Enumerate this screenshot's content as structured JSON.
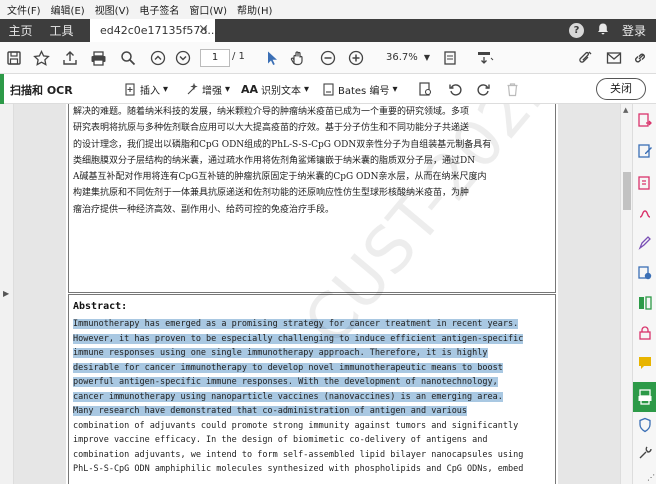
{
  "menubar": [
    "文件(F)",
    "编辑(E)",
    "视图(V)",
    "电子签名",
    "窗口(W)",
    "帮助(H)"
  ],
  "tabs": {
    "home": "主页",
    "tools": "工具",
    "document": "ed42c0e17135f57d...",
    "close_symbol": "×",
    "help_symbol": "?",
    "login": "登录"
  },
  "toolbar": {
    "page_current": "1",
    "page_total": "/ 1",
    "zoom": "36.7%"
  },
  "ocr": {
    "title": "扫描和 OCR",
    "insert": "插入",
    "enhance": "增强",
    "recognize_text": "识别文本",
    "bates": "Bates 编号",
    "close": "关闭"
  },
  "document": {
    "chinese_lines": [
      "解决的难题。随着纳米科技的发展，纳米颗粒介导的肿瘤纳米疫苗已成为一个重要的研究领域。多项",
      "研究表明将抗原与多种佐剂联合应用可以大大提高疫苗的疗效。基于分子仿生和不同功能分子共递送",
      "的设计理念，我们提出以磷脂和CpG  ODN组成的PhL-S-S-CpG  ODN双亲性分子为自组装基元制备具有",
      "类细胞膜双分子层结构的纳米囊，通过疏水作用将佐剂角鲨烯镶嵌于纳米囊的脂质双分子层，通过DN",
      "A碱基互补配对作用将连有CpG互补链的肿瘤抗原固定于纳米囊的CpG  ODN亲水层，从而在纳米尺度内",
      "构建集抗原和不同佐剂于一体兼具抗原递送和佐剂功能的还原响应性仿生型球形核酸纳米疫苗，为肿",
      "瘤治疗提供一种经济高效、副作用小、给药可控的免疫治疗手段。"
    ],
    "abstract_title": "Abstract:",
    "abstract_lines": [
      {
        "text": "Immunotherapy has emerged as a promising strategy for cancer treatment in recent years.",
        "highlight": true
      },
      {
        "text": "However, it has proven to be especially challenging to induce efficient antigen-specific",
        "highlight": true
      },
      {
        "text": "immune responses using one single immunotherapy approach. Therefore, it is highly",
        "highlight": true
      },
      {
        "text": "desirable for cancer immunotherapy to develop novel immunotherapeutic means to boost",
        "highlight": true
      },
      {
        "text": "powerful antigen-specific immune responses. With the development of nanotechnology,",
        "highlight": true
      },
      {
        "text": "cancer immunotherapy using nanoparticle vaccines (nanovaccines) is an emerging area.",
        "highlight": true
      },
      {
        "text": "Many research have demonstrated that co-administration of antigen and various",
        "highlight": true
      },
      {
        "text": "combination of adjuvants could promote strong immunity against tumors and significantly",
        "highlight": false
      },
      {
        "text": "improve vaccine efficacy. In the design of biomimetic co-delivery of antigens and",
        "highlight": false
      },
      {
        "text": "combination adjuvants, we intend to form self-assembled lipid bilayer nanocapsules using",
        "highlight": false
      },
      {
        "text": "PhL-S-S-CpG ODN amphiphilic molecules synthesized with phospholipids and CpG ODNs, embed",
        "highlight": false
      }
    ],
    "watermark": "CUST-2022"
  },
  "colors": {
    "accent_green": "#2d9a48",
    "tab_bar": "#3d3d3d",
    "selection": "#a9c8e2"
  }
}
